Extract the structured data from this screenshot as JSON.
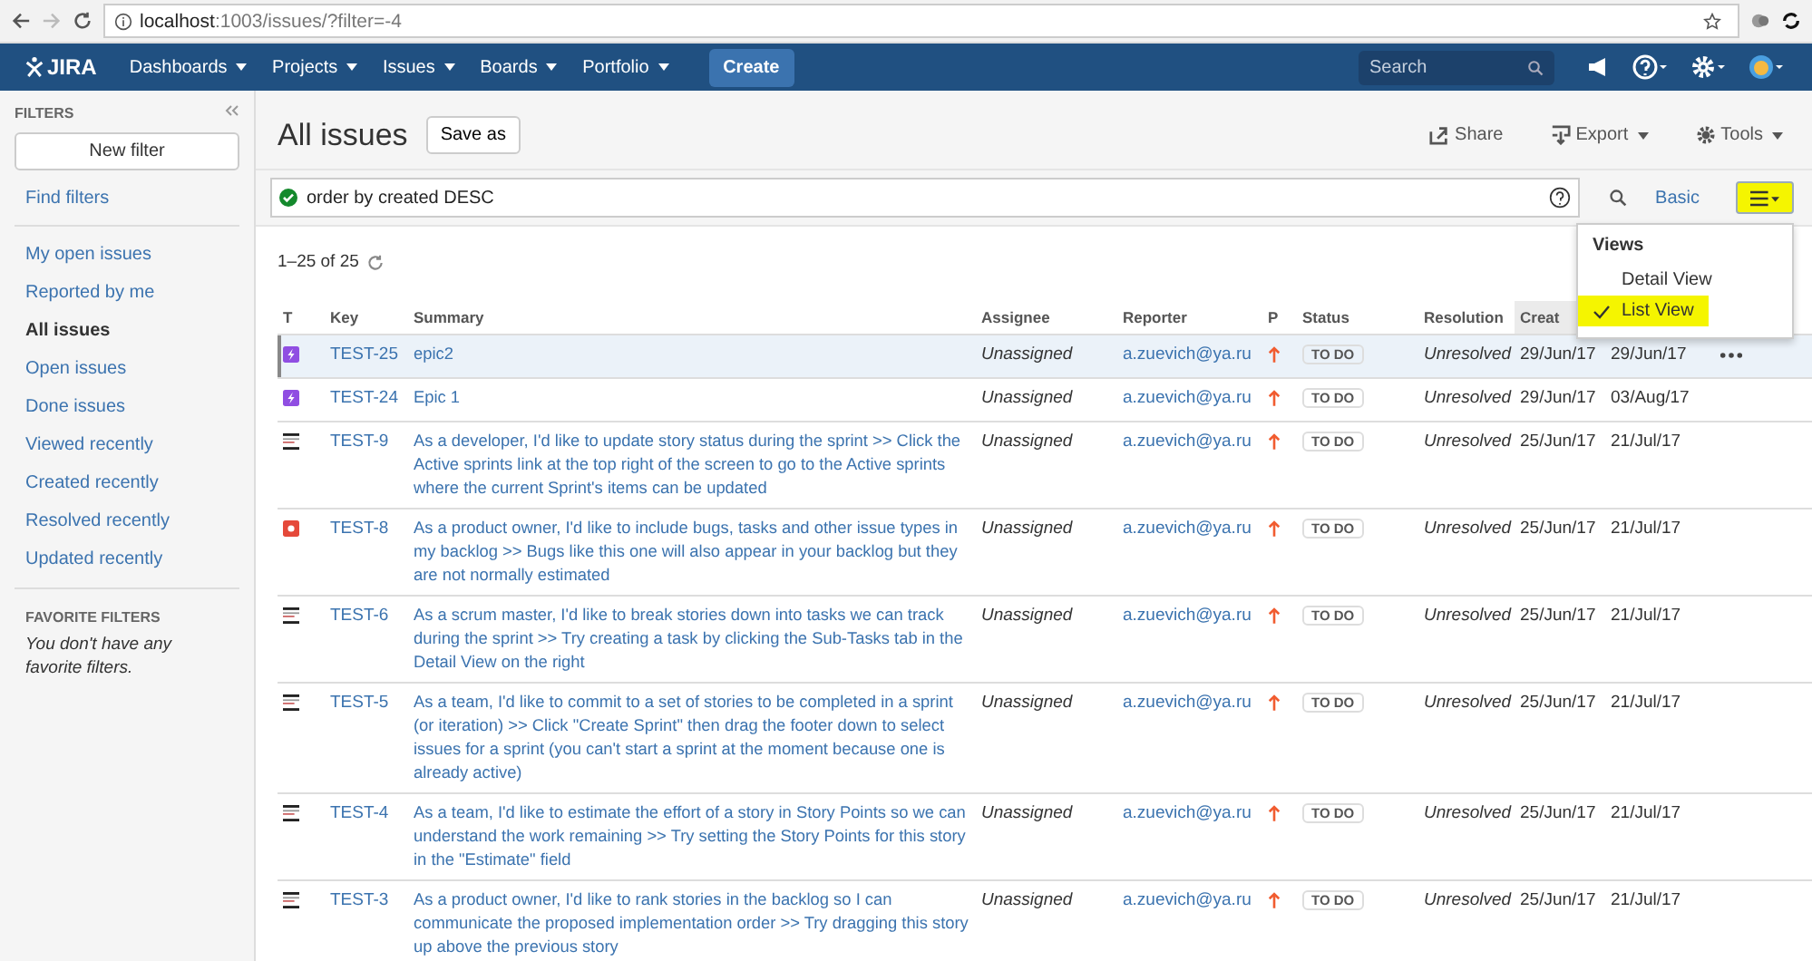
{
  "browser": {
    "url_host": "localhost",
    "url_path": ":1003/issues/?filter=-4"
  },
  "nav": {
    "logo": "JIRA",
    "menus": [
      "Dashboards",
      "Projects",
      "Issues",
      "Boards",
      "Portfolio"
    ],
    "create": "Create",
    "search": {
      "placeholder": "Search"
    }
  },
  "sidebar": {
    "title": "FILTERS",
    "new_filter": "New filter",
    "find_filters": "Find filters",
    "items": [
      {
        "label": "My open issues",
        "selected": false
      },
      {
        "label": "Reported by me",
        "selected": false
      },
      {
        "label": "All issues",
        "selected": true
      },
      {
        "label": "Open issues",
        "selected": false
      },
      {
        "label": "Done issues",
        "selected": false
      },
      {
        "label": "Viewed recently",
        "selected": false
      },
      {
        "label": "Created recently",
        "selected": false
      },
      {
        "label": "Resolved recently",
        "selected": false
      },
      {
        "label": "Updated recently",
        "selected": false
      }
    ],
    "favorites_title": "FAVORITE FILTERS",
    "favorites_empty": "You don't have any favorite filters."
  },
  "page": {
    "title": "All issues",
    "save_as": "Save as",
    "actions": [
      "Share",
      "Export",
      "Tools"
    ],
    "query": "order by created DESC",
    "basic": "Basic",
    "count": "1–25 of 25"
  },
  "views_menu": {
    "title": "Views",
    "items": [
      {
        "label": "Detail View",
        "selected": false
      },
      {
        "label": "List View",
        "selected": true
      }
    ]
  },
  "table": {
    "columns": [
      "T",
      "Key",
      "Summary",
      "Assignee",
      "Reporter",
      "P",
      "Status",
      "Resolution",
      "Creat"
    ],
    "rows": [
      {
        "kind": "epic",
        "key": "TEST-25",
        "summary": "epic2",
        "assignee": "Unassigned",
        "reporter": "a.zuevich@ya.ru",
        "status": "TO DO",
        "resolution": "Unresolved",
        "created": "29/Jun/17",
        "column_10": "29/Jun/17",
        "selected": true
      },
      {
        "kind": "epic",
        "key": "TEST-24",
        "summary": "Epic 1",
        "assignee": "Unassigned",
        "reporter": "a.zuevich@ya.ru",
        "status": "TO DO",
        "resolution": "Unresolved",
        "created": "29/Jun/17",
        "column_10": "03/Aug/17",
        "selected": false
      },
      {
        "kind": "story",
        "key": "TEST-9",
        "summary": "As a developer, I'd like to update story status during the sprint >> Click the Active sprints link at the top right of the screen to go to the Active sprints where the current Sprint's items can be updated",
        "assignee": "Unassigned",
        "reporter": "a.zuevich@ya.ru",
        "status": "TO DO",
        "resolution": "Unresolved",
        "created": "25/Jun/17",
        "column_10": "21/Jul/17",
        "selected": false
      },
      {
        "kind": "bug",
        "key": "TEST-8",
        "summary": "As a product owner, I'd like to include bugs, tasks and other issue types in my backlog >> Bugs like this one will also appear in your backlog but they are not normally estimated",
        "assignee": "Unassigned",
        "reporter": "a.zuevich@ya.ru",
        "status": "TO DO",
        "resolution": "Unresolved",
        "created": "25/Jun/17",
        "column_10": "21/Jul/17",
        "selected": false
      },
      {
        "kind": "story",
        "key": "TEST-6",
        "summary": "As a scrum master, I'd like to break stories down into tasks we can track during the sprint >> Try creating a task by clicking the Sub-Tasks tab in the Detail View on the right",
        "assignee": "Unassigned",
        "reporter": "a.zuevich@ya.ru",
        "status": "TO DO",
        "resolution": "Unresolved",
        "created": "25/Jun/17",
        "column_10": "21/Jul/17",
        "selected": false
      },
      {
        "kind": "story",
        "key": "TEST-5",
        "summary": "As a team, I'd like to commit to a set of stories to be completed in a sprint (or iteration) >> Click \"Create Sprint\" then drag the footer down to select issues for a sprint (you can't start a sprint at the moment because one is already active)",
        "assignee": "Unassigned",
        "reporter": "a.zuevich@ya.ru",
        "status": "TO DO",
        "resolution": "Unresolved",
        "created": "25/Jun/17",
        "column_10": "21/Jul/17",
        "selected": false
      },
      {
        "kind": "story",
        "key": "TEST-4",
        "summary": "As a team, I'd like to estimate the effort of a story in Story Points so we can understand the work remaining >> Try setting the Story Points for this story in the \"Estimate\" field",
        "assignee": "Unassigned",
        "reporter": "a.zuevich@ya.ru",
        "status": "TO DO",
        "resolution": "Unresolved",
        "created": "25/Jun/17",
        "column_10": "21/Jul/17",
        "selected": false
      },
      {
        "kind": "story",
        "key": "TEST-3",
        "summary": "As a product owner, I'd like to rank stories in the backlog so I can communicate the proposed implementation order >> Try dragging this story up above the previous story",
        "assignee": "Unassigned",
        "reporter": "a.zuevich@ya.ru",
        "status": "TO DO",
        "resolution": "Unresolved",
        "created": "25/Jun/17",
        "column_10": "21/Jul/17",
        "selected": false
      }
    ]
  }
}
